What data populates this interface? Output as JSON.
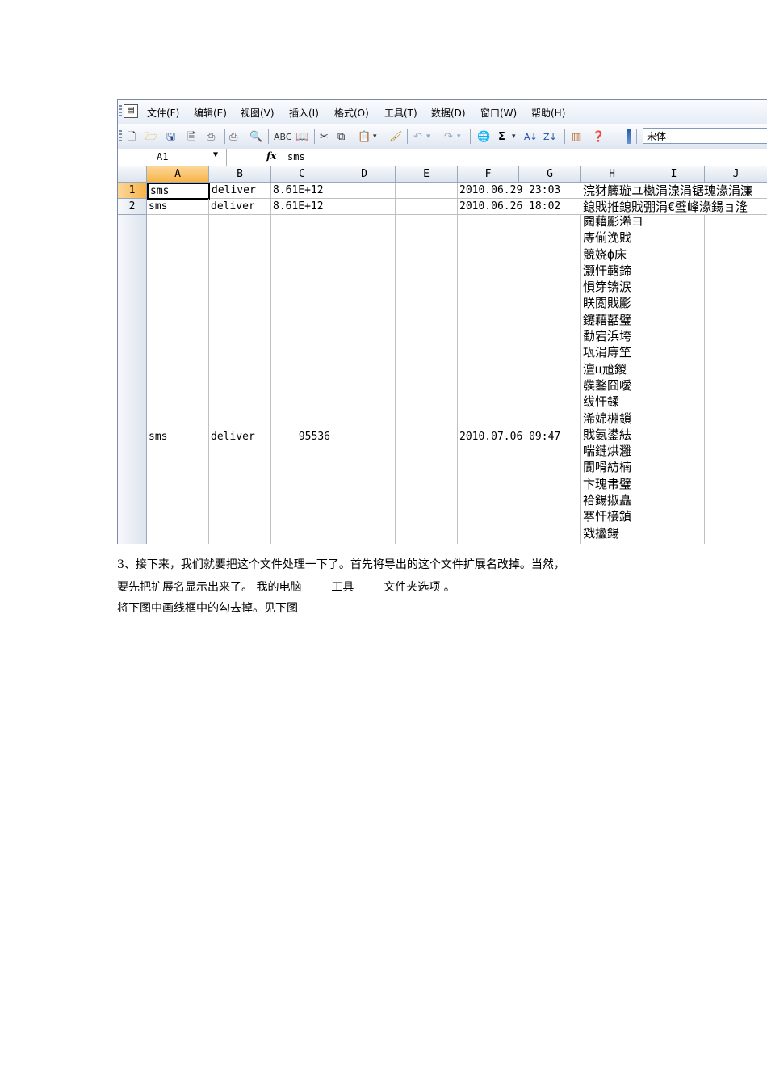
{
  "menubar": {
    "items": [
      "文件(F)",
      "编辑(E)",
      "视图(V)",
      "插入(I)",
      "格式(O)",
      "工具(T)",
      "数据(D)",
      "窗口(W)",
      "帮助(H)"
    ]
  },
  "toolbar": {
    "font_name": "宋体",
    "icons": [
      "new-icon",
      "open-icon",
      "save-icon",
      "permission-icon",
      "print-icon",
      "print-preview-icon",
      "spelling-icon",
      "research-icon",
      "cut-icon",
      "copy-icon",
      "paste-icon",
      "format-painter-icon",
      "undo-icon",
      "redo-icon",
      "hyperlink-icon",
      "autosum-icon",
      "sort-ascending-icon",
      "sort-descending-icon",
      "chart-icon",
      "help-icon"
    ]
  },
  "formula_bar": {
    "name_box": "A1",
    "fx_label": "fx",
    "value": "sms"
  },
  "sheet": {
    "columns": [
      "A",
      "B",
      "C",
      "D",
      "E",
      "F",
      "G",
      "H",
      "I",
      "J"
    ],
    "row_headers": [
      "1",
      "2",
      ""
    ],
    "rows": [
      {
        "A": "sms",
        "B": "deliver",
        "C": "8.61E+12",
        "F": "2010.06.29 23:03",
        "H": "浣犲簲璇ユ槸涓湶涓锯瑰湪涓濂"
      },
      {
        "A": "sms",
        "B": "deliver",
        "C": "8.61E+12",
        "F": "2010.06.26 18:02",
        "H": "鎴戝拰鎴戝弸涓€璧峰湪鍚ョ湰"
      },
      {
        "A": "sms",
        "B": "deliver",
        "C": "95536",
        "F": "2010.07.06 09:47",
        "H": "閮藉彲浠ヨ\n庤偂浼戝\n競娆ф床\n灏忓簵鍗\n愪笌锛涙\n眹閲戝彲\n鑳藉嚭璧\n勫宕浜垮\n瓨涓庤笁\n澶ц兘鍐\n彂鐜囧噯\n绂忓鍒\n浠婂棩鎻\n戝氨鍙紶\n喘鏈烘灉\n閬嗗紡楠\n卞瑰帇璧\n袷鍚掓矗\n搴忓椄鍞\n戣攭鍚"
      }
    ]
  },
  "document": {
    "paragraphs": [
      "3、接下来，我们就要把这个文件处理一下了。首先将导出的这个文件扩展名改掉。当然，",
      "要先把扩展名显示出来了。 我的电脑 　　 工具 　　 文件夹选项 。",
      "将下图中画线框中的勾去掉。见下图"
    ]
  }
}
